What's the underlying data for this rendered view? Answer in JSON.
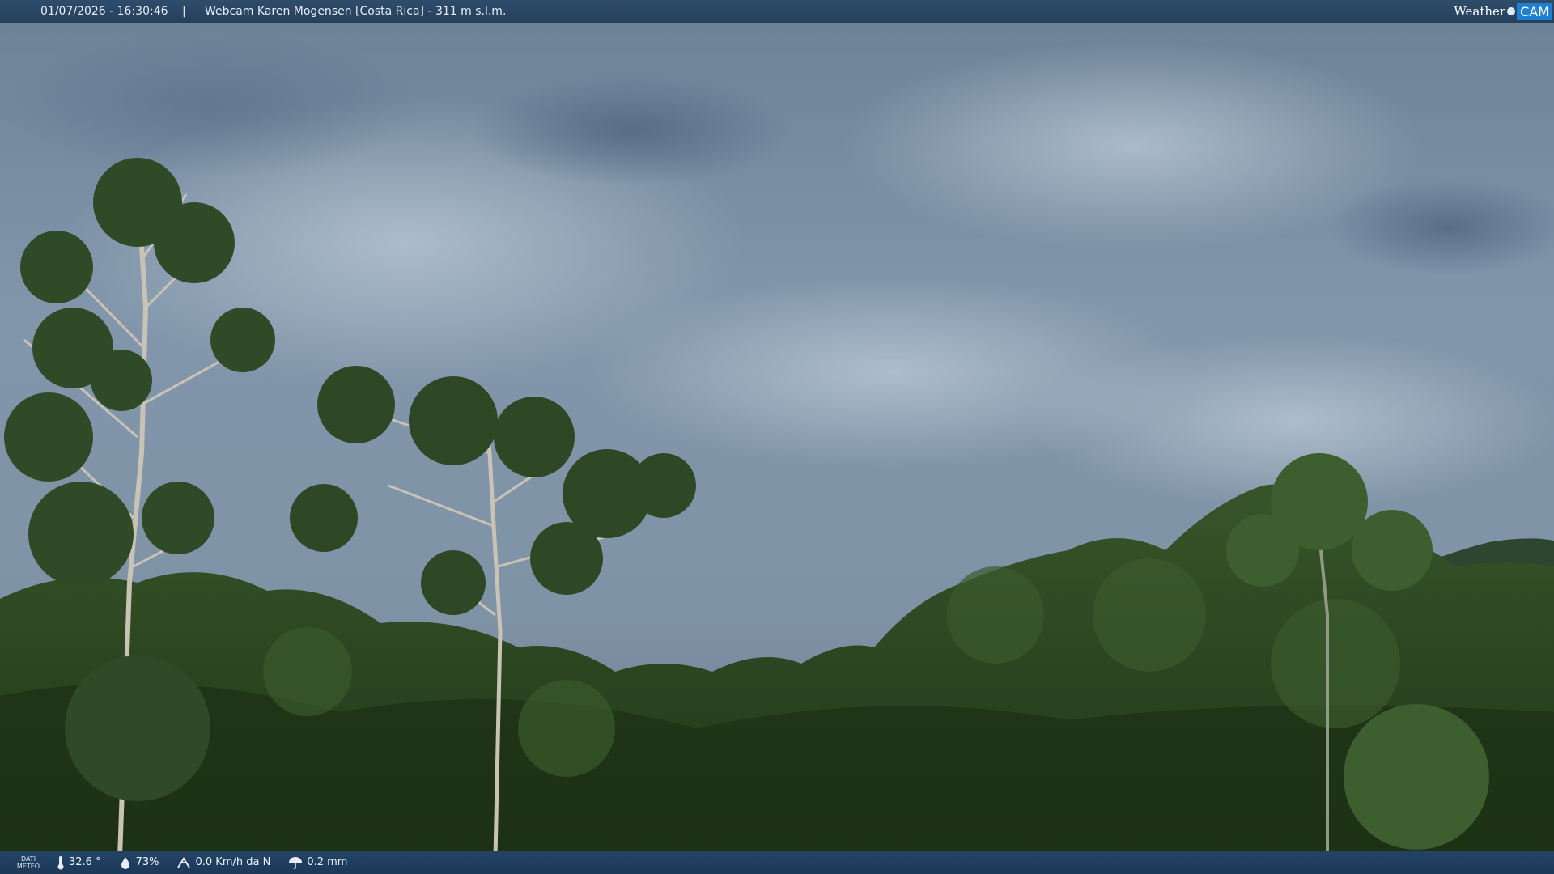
{
  "header": {
    "datetime": "01/07/2026 - 16:30:46",
    "separator": "|",
    "title": "Webcam Karen Mogensen [Costa Rica] - 311 m s.l.m.",
    "logo": {
      "word": "Weather",
      "cam": "CAM"
    }
  },
  "footer": {
    "label_line1": "DATI",
    "label_line2": "METEO",
    "temperature": "32.6 °",
    "humidity": "73%",
    "wind": "0.0 Km/h da N",
    "rain": "0.2 mm"
  },
  "icons": {
    "temperature": "thermometer-icon",
    "humidity": "humidity-drop-icon",
    "wind": "wind-icon",
    "rain": "rain-umbrella-icon"
  },
  "colors": {
    "bar": "#25405d",
    "logo_cam": "#1f7fd0",
    "sky": "#7d93a8",
    "foliage": "#2c4620"
  }
}
